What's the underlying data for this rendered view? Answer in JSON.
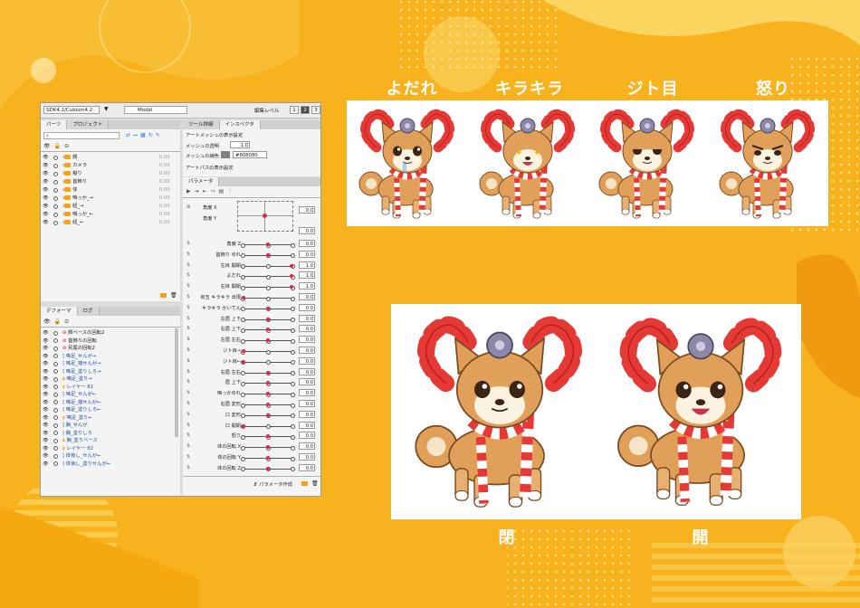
{
  "colors": {
    "background": "#f7b21e",
    "accent": "#d9294f",
    "folder": "#f3a21a"
  },
  "toolbar": {
    "path": "SDK4.2/Cubism4.2",
    "model": "Model",
    "level_label": "編集レベル",
    "levels": [
      "1",
      "2",
      "3"
    ]
  },
  "parts": {
    "tabs": [
      "パーツ",
      "プロジェクト"
    ],
    "items": [
      "顔",
      "カメラ",
      "擬り",
      "首飾り",
      "体",
      "鳴っか_→",
      "紐_→",
      "鳴っか_←",
      "紐_←"
    ],
    "value": "0.00"
  },
  "inspector": {
    "tabs": [
      "ツール詳細",
      "インスペクタ"
    ],
    "section1": "アートメッシュの表示設定",
    "mesh_opacity_label": "メッシュの透明",
    "mesh_opacity_value": "1.0",
    "mesh_color_label": "メッシュの線色",
    "mesh_color_value": "#808080",
    "section2": "アートパスの表示設定"
  },
  "params": {
    "tab": "パラメータ",
    "angle_x": "角度 X",
    "angle_y": "角度 Y",
    "xy_values": [
      "0.0",
      "0.0"
    ],
    "rows": [
      {
        "name": "角度 Z",
        "value": "0.0"
      },
      {
        "name": "首飾り ゆれ",
        "value": "0.0"
      },
      {
        "name": "左目 開閉",
        "value": "1.0"
      },
      {
        "name": "よだれ",
        "value": "1.0"
      },
      {
        "name": "右目 開閉",
        "value": "1.0"
      },
      {
        "name": "目玉 キラキラ 出現",
        "value": "0.0"
      },
      {
        "name": "キラキラ かいてん",
        "value": "0.0"
      },
      {
        "name": "左眉 上下",
        "value": "0.0"
      },
      {
        "name": "右眉 上下",
        "value": "0.0"
      },
      {
        "name": "左眉 左右",
        "value": "0.0"
      },
      {
        "name": "ジト目→",
        "value": "0.0"
      },
      {
        "name": "ジト目←",
        "value": "0.0"
      },
      {
        "name": "右眉 左右",
        "value": "0.0"
      },
      {
        "name": "眉 上下",
        "value": "0.0"
      },
      {
        "name": "鳴っかゆれ",
        "value": "0.0"
      },
      {
        "name": "右眉 変形",
        "value": "0.0"
      },
      {
        "name": "口 変形",
        "value": "0.0"
      },
      {
        "name": "口 開閉",
        "value": "0.0"
      },
      {
        "name": "怒り",
        "value": "0.0"
      },
      {
        "name": "体の回転 X",
        "value": "0.0"
      },
      {
        "name": "体の回転 Y",
        "value": "0.0"
      },
      {
        "name": "体の回転 Z",
        "value": "0.0"
      }
    ],
    "create_button": "パラメータ作成"
  },
  "deformer": {
    "tabs": [
      "デフォーマ",
      "ログ"
    ],
    "items": [
      "顔ベースの回転2",
      "首飾りの回転",
      "尻尾の回転2",
      "鳴足_せんが→",
      "鳴足_揺せんが→",
      "鳴足_塗りしろ→",
      "鳴足_塗り→",
      "レイヤー 81",
      "鳴足_せんが←",
      "鳴足_揺せんが←",
      "鳴足_塗りしろ←",
      "鳴足_塗り←",
      "胸_せんが",
      "胸_塗りしろ",
      "胸_塗りベース",
      "レイヤー 82",
      "体後し_せんが←",
      "体後し_塗りせんが←"
    ]
  },
  "showcase": {
    "top_labels": [
      "よだれ",
      "キラキラ",
      "ジト目",
      "怒り"
    ],
    "bottom_labels": [
      "閉",
      "開"
    ]
  }
}
